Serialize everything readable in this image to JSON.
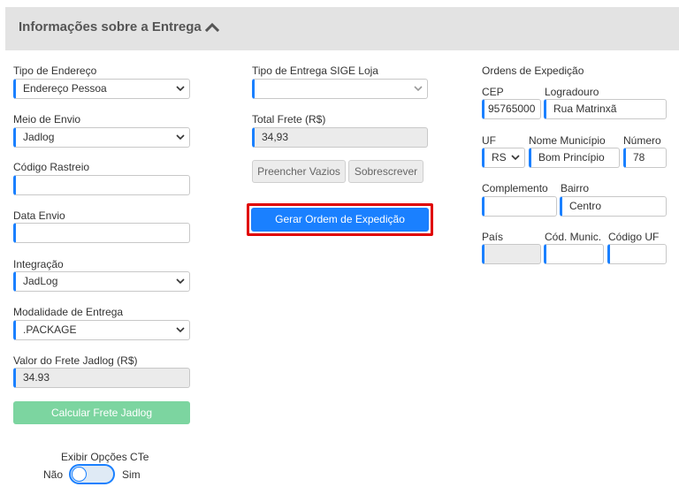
{
  "header": {
    "title": "Informações sobre a Entrega",
    "collapse_icon": "chevron-up-icon"
  },
  "left": {
    "tipo_endereco": {
      "label": "Tipo de Endereço",
      "value": "Endereço Pessoa"
    },
    "meio_envio": {
      "label": "Meio de Envio",
      "value": "Jadlog"
    },
    "codigo_rastreio": {
      "label": "Código Rastreio",
      "value": ""
    },
    "data_envio": {
      "label": "Data Envio",
      "value": ""
    },
    "integracao": {
      "label": "Integração",
      "value": "JadLog"
    },
    "modalidade": {
      "label": "Modalidade de Entrega",
      "value": ".PACKAGE"
    },
    "valor_frete": {
      "label": "Valor do Frete Jadlog (R$)",
      "value": "34.93"
    },
    "calcular_button": "Calcular Frete Jadlog",
    "cte": {
      "label": "Exibir Opções CTe",
      "off_label": "Não",
      "on_label": "Sim",
      "state": "off"
    }
  },
  "middle": {
    "tipo_entrega": {
      "label": "Tipo de Entrega SIGE Loja",
      "value": ""
    },
    "total_frete": {
      "label": "Total Frete (R$)",
      "value": "34,93"
    },
    "preencher_button": "Preencher Vazios",
    "sobrescrever_button": "Sobrescrever",
    "gerar_button": "Gerar Ordem de Expedição"
  },
  "right": {
    "section_title": "Ordens de Expedição",
    "cep": {
      "label": "CEP",
      "value": "95765000"
    },
    "logradouro": {
      "label": "Logradouro",
      "value": "Rua Matrinxã"
    },
    "uf": {
      "label": "UF",
      "value": "RS"
    },
    "municipio": {
      "label": "Nome Município",
      "value": "Bom Princípio"
    },
    "numero": {
      "label": "Número",
      "value": "78"
    },
    "complemento": {
      "label": "Complemento",
      "value": ""
    },
    "bairro": {
      "label": "Bairro",
      "value": "Centro"
    },
    "pais": {
      "label": "País",
      "value": ""
    },
    "cod_munic": {
      "label": "Cód. Munic.",
      "value": ""
    },
    "codigo_uf": {
      "label": "Código UF",
      "value": ""
    }
  },
  "colors": {
    "accent": "#1a80ff",
    "highlight": "#e00000",
    "success": "#7cd5a0",
    "header_bg": "#e3e3e3",
    "readonly_bg": "#ebebeb"
  }
}
